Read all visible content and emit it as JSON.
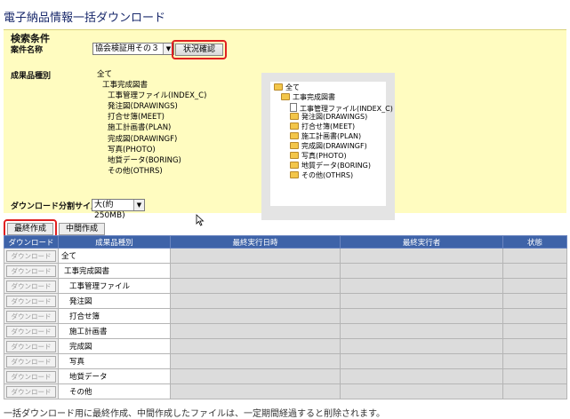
{
  "page": {
    "title": "電子納品情報一括ダウンロード",
    "footnote": "一括ダウンロード用に最終作成、中間作成したファイルは、一定期間経過すると削除されます。"
  },
  "search": {
    "heading": "検索条件",
    "project_label": "案件名称",
    "project_value": "協会検証用その３",
    "status_button": "状況確認",
    "category_label": "成果品種別",
    "categories": [
      "全て",
      "工事完成図書",
      "工事管理ファイル(INDEX_C)",
      "発注図(DRAWINGS)",
      "打合せ簿(MEET)",
      "施工計画書(PLAN)",
      "完成図(DRAWINGF)",
      "写真(PHOTO)",
      "地質データ(BORING)",
      "その他(OTHRS)"
    ],
    "split_label": "ダウンロード分割サイズ",
    "split_value": "大(約250MB)"
  },
  "tree": {
    "root": "全て",
    "group": "工事完成図書",
    "file": "工事管理ファイル(INDEX_C)",
    "children": [
      "発注図(DRAWINGS)",
      "打合せ簿(MEET)",
      "施工計画書(PLAN)",
      "完成図(DRAWINGF)",
      "写真(PHOTO)",
      "地質データ(BORING)",
      "その他(OTHRS)"
    ]
  },
  "actions": {
    "final_button": "最終作成",
    "interim_button": "中間作成"
  },
  "table": {
    "headers": [
      "ダウンロード",
      "成果品種別",
      "最終実行日時",
      "最終実行者",
      "状態"
    ],
    "download_label": "ダウンロード",
    "rows": [
      "全て",
      "工事完成図書",
      "工事管理ファイル",
      "発注図",
      "打合せ簿",
      "施工計画書",
      "完成図",
      "写真",
      "地質データ",
      "その他"
    ]
  },
  "colors": {
    "panel_background": "#fffcc0",
    "table_header": "#3e63a8",
    "highlight": "#e02020",
    "title": "#1a2a6c"
  }
}
